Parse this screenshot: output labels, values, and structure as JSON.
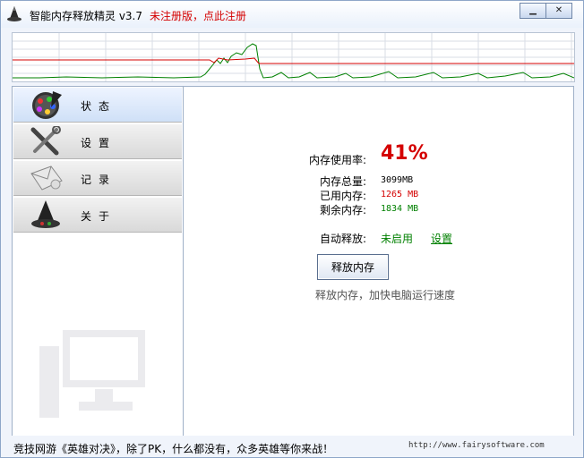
{
  "title": {
    "app_name": "智能内存释放精灵 v3.7",
    "register_link": "未注册版，点此注册"
  },
  "window_controls": {
    "minimize": "▁",
    "close": "✕"
  },
  "nav": [
    {
      "label": "状态",
      "icon": "palette-icon"
    },
    {
      "label": "设置",
      "icon": "tools-icon"
    },
    {
      "label": "记录",
      "icon": "envelope-icon"
    },
    {
      "label": "关于",
      "icon": "wizard-hat-icon"
    }
  ],
  "memory": {
    "usage_label": "内存使用率:",
    "usage_value": "41%",
    "total_label": "内存总量:",
    "total_value": "3099MB",
    "used_label": "已用内存:",
    "used_value": "1265 MB",
    "free_label": "剩余内存:",
    "free_value": "1834 MB",
    "auto_release_label": "自动释放:",
    "auto_release_status": "未启用",
    "settings_link": "设置",
    "release_button": "释放内存",
    "release_hint": "释放内存，加快电脑运行速度"
  },
  "status_bar": {
    "promo": "竞技网游《英雄对决》，除了PK，什么都没有，众多英雄等你来战！",
    "website": "http://www.fairysoftware.com"
  },
  "colors": {
    "accent_red": "#d40000",
    "value_green": "#008000",
    "graph_red_line": "#d40000",
    "graph_green_line": "#008000"
  }
}
